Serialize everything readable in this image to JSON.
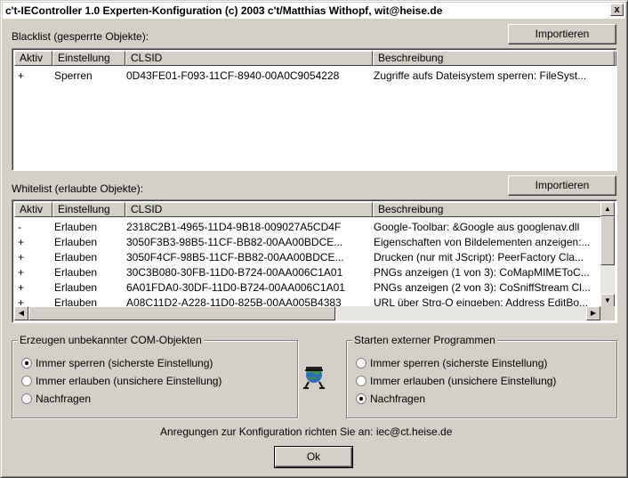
{
  "window": {
    "title": "c't-IEController 1.0 Experten-Konfiguration  (c) 2003 c't/Matthias Withopf, wit@heise.de",
    "close_label": "x"
  },
  "blacklist": {
    "label": "Blacklist (gesperrte Objekte):",
    "import_label": "Importieren",
    "columns": [
      "Aktiv",
      "Einstellung",
      "CLSID",
      "Beschreibung"
    ],
    "rows": [
      {
        "aktiv": "+",
        "einstellung": "Sperren",
        "clsid": "0D43FE01-F093-11CF-8940-00A0C9054228",
        "beschreibung": "Zugriffe aufs Dateisystem sperren: FileSyst..."
      }
    ]
  },
  "whitelist": {
    "label": "Whitelist (erlaubte Objekte):",
    "import_label": "Importieren",
    "columns": [
      "Aktiv",
      "Einstellung",
      "CLSID",
      "Beschreibung"
    ],
    "rows": [
      {
        "aktiv": "-",
        "einstellung": "Erlauben",
        "clsid": "2318C2B1-4965-11D4-9B18-009027A5CD4F",
        "beschreibung": "Google-Toolbar: &Google aus googlenav.dll"
      },
      {
        "aktiv": "+",
        "einstellung": "Erlauben",
        "clsid": "3050F3B3-98B5-11CF-BB82-00AA00BDCE...",
        "beschreibung": "Eigenschaften von Bildelementen anzeigen:..."
      },
      {
        "aktiv": "+",
        "einstellung": "Erlauben",
        "clsid": "3050F4CF-98B5-11CF-BB82-00AA00BDCE...",
        "beschreibung": "Drucken (nur mit JScript): PeerFactory Cla..."
      },
      {
        "aktiv": "+",
        "einstellung": "Erlauben",
        "clsid": "30C3B080-30FB-11D0-B724-00AA006C1A01",
        "beschreibung": "PNGs anzeigen (1 von 3): CoMapMIMEToC..."
      },
      {
        "aktiv": "+",
        "einstellung": "Erlauben",
        "clsid": "6A01FDA0-30DF-11D0-B724-00AA006C1A01",
        "beschreibung": "PNGs anzeigen (2 von 3): CoSniffStream Cl..."
      },
      {
        "aktiv": "+",
        "einstellung": "Erlauben",
        "clsid": "A08C11D2-A228-11D0-825B-00AA005B4383",
        "beschreibung": "URL über Strg-O eingeben: Address EditBo..."
      }
    ]
  },
  "com_group": {
    "title": "Erzeugen unbekannter COM-Objekten",
    "options": [
      {
        "label": "Immer sperren (sicherste Einstellung)",
        "checked": true
      },
      {
        "label": "Immer erlauben (unsichere Einstellung)",
        "checked": false
      },
      {
        "label": "Nachfragen",
        "checked": false
      }
    ]
  },
  "prog_group": {
    "title": "Starten externer Programmen",
    "options": [
      {
        "label": "Immer sperren (sicherste Einstellung)",
        "checked": false
      },
      {
        "label": "Immer erlauben (unsichere Einstellung)",
        "checked": false
      },
      {
        "label": "Nachfragen",
        "checked": true
      }
    ]
  },
  "footer": {
    "text": "Anregungen zur Konfiguration richten Sie an: iec@ct.heise.de",
    "ok_label": "Ok"
  },
  "icons": {
    "logo": "globe-agent-icon"
  }
}
